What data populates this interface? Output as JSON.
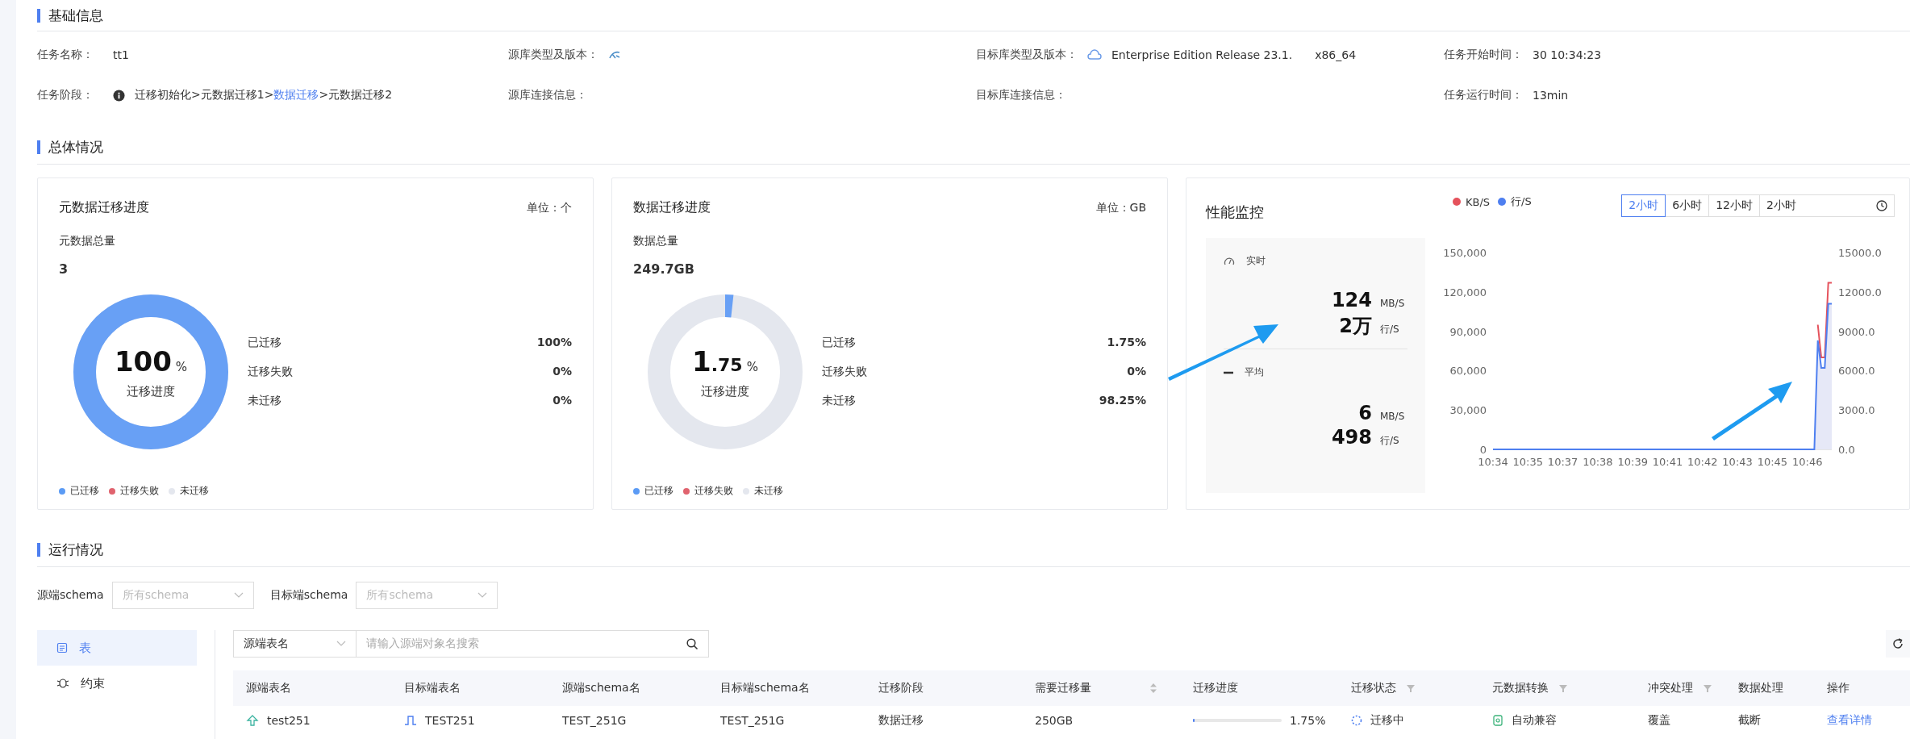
{
  "basic_info": {
    "title": "基础信息",
    "rows": [
      {
        "fields": [
          {
            "kind": "text",
            "label": "任务名称：",
            "value": "tt1"
          },
          {
            "kind": "icon",
            "label": "源库类型及版本："
          },
          {
            "kind": "icon_text",
            "label": "目标库类型及版本：",
            "value": "Enterprise Edition Release 23.1.",
            "extra": "x86_64"
          },
          {
            "kind": "text",
            "label": "任务开始时间：",
            "value": "30 10:34:23"
          }
        ]
      },
      {
        "fields": [
          {
            "kind": "stages",
            "label": "任务阶段：",
            "separator": ">",
            "stages": [
              {
                "text": "迁移初始化",
                "selected": false
              },
              {
                "text": "元数据迁移1",
                "selected": false
              },
              {
                "text": "数据迁移",
                "selected": true
              },
              {
                "text": "元数据迁移2",
                "selected": false
              }
            ]
          },
          {
            "kind": "label",
            "label": "源库连接信息："
          },
          {
            "kind": "label",
            "label": "目标库连接信息："
          },
          {
            "kind": "text",
            "label": "任务运行时间：",
            "value": "13min"
          }
        ]
      }
    ]
  },
  "overview": {
    "title": "总体情况",
    "cards": [
      {
        "title": "元数据迁移进度",
        "unit": "单位：个",
        "total_label": "元数据总量",
        "total": "3",
        "level": 1,
        "center_int": "100",
        "center_unit": "%",
        "center_label": "迁移进度",
        "stats": [
          {
            "label": "已迁移",
            "value": "100%"
          },
          {
            "label": "迁移失败",
            "value": "0%"
          },
          {
            "label": "未迁移",
            "value": "0%"
          }
        ],
        "legend": [
          {
            "label": "已迁移",
            "color": "#5b9bf5"
          },
          {
            "label": "迁移失败",
            "color": "#e0636e"
          },
          {
            "label": "未迁移",
            "color": "#e4e7ee"
          }
        ]
      },
      {
        "title": "数据迁移进度",
        "unit": "单位：GB",
        "total_label": "数据总量",
        "total": "249.7GB",
        "level": 0.0175,
        "center_int": "1",
        "center_frac": ".75",
        "center_unit": "%",
        "center_label": "迁移进度",
        "stats": [
          {
            "label": "已迁移",
            "value": "1.75%"
          },
          {
            "label": "迁移失败",
            "value": "0%"
          },
          {
            "label": "未迁移",
            "value": "98.25%"
          }
        ],
        "legend": [
          {
            "label": "已迁移",
            "color": "#5b9bf5"
          },
          {
            "label": "迁移失败",
            "color": "#e0636e"
          },
          {
            "label": "未迁移",
            "color": "#e4e7ee"
          }
        ]
      }
    ],
    "monitor": {
      "title": "性能监控",
      "realtime": {
        "label": "实时",
        "rows": [
          {
            "value": "124",
            "unit": "MB/S"
          },
          {
            "value": "2万",
            "unit": "行/S"
          }
        ]
      },
      "average": {
        "label": "平均",
        "rows": [
          {
            "value": "6",
            "unit": "MB/S"
          },
          {
            "value": "498",
            "unit": "行/S"
          }
        ]
      },
      "ranges": [
        {
          "label": "2小时",
          "selected": true
        },
        {
          "label": "6小时",
          "selected": false
        },
        {
          "label": "12小时",
          "selected": false
        }
      ],
      "range_select": "2小时",
      "chart_data": {
        "type": "line",
        "categories": [
          "10:34",
          null,
          null,
          null,
          null,
          null,
          null,
          null,
          null,
          null,
          "10:35",
          null,
          null,
          null,
          null,
          null,
          null,
          null,
          null,
          null,
          "10:37",
          null,
          null,
          null,
          null,
          null,
          null,
          null,
          null,
          null,
          "10:38",
          null,
          null,
          null,
          null,
          null,
          null,
          null,
          null,
          null,
          "10:39",
          null,
          null,
          null,
          null,
          null,
          null,
          null,
          null,
          null,
          "10:41",
          null,
          null,
          null,
          null,
          null,
          null,
          null,
          null,
          null,
          "10:42",
          null,
          null,
          null,
          null,
          null,
          null,
          null,
          null,
          null,
          "10:43",
          null,
          null,
          null,
          null,
          null,
          null,
          null,
          null,
          null,
          "10:45",
          null,
          null,
          null,
          null,
          null,
          null,
          null,
          null,
          null,
          "10:46",
          null,
          null,
          null,
          null,
          null,
          null,
          null
        ],
        "ylim": [
          0,
          150000
        ],
        "yticks": [
          {
            "value": 0,
            "label": "0"
          },
          {
            "value": 30000,
            "label": "30,000"
          },
          {
            "value": 60000,
            "label": "60,000"
          },
          {
            "value": 90000,
            "label": "90,000"
          },
          {
            "value": 120000,
            "label": "120,000"
          },
          {
            "value": 150000,
            "label": "150,000"
          }
        ],
        "y2lim": [
          0,
          15000
        ],
        "y2ticks": [
          {
            "value": 0,
            "label": "0.0"
          },
          {
            "value": 3000,
            "label": "3000.0"
          },
          {
            "value": 6000,
            "label": "6000.0"
          },
          {
            "value": 9000,
            "label": "9000.0"
          },
          {
            "value": 12000,
            "label": "12000.0"
          },
          {
            "value": 15000,
            "label": "15000.0"
          }
        ],
        "series": [
          {
            "name": "KB/S",
            "color": "#e5525c",
            "values": [
              null,
              null,
              null,
              null,
              null,
              null,
              null,
              null,
              null,
              null,
              null,
              null,
              null,
              null,
              null,
              null,
              null,
              null,
              null,
              null,
              null,
              null,
              null,
              null,
              null,
              null,
              null,
              null,
              null,
              null,
              null,
              null,
              null,
              null,
              null,
              null,
              null,
              null,
              null,
              null,
              null,
              null,
              null,
              null,
              null,
              null,
              null,
              null,
              null,
              null,
              null,
              null,
              null,
              null,
              null,
              null,
              null,
              null,
              null,
              null,
              null,
              null,
              null,
              null,
              null,
              null,
              null,
              null,
              null,
              null,
              null,
              null,
              null,
              null,
              null,
              null,
              null,
              null,
              null,
              null,
              null,
              null,
              null,
              null,
              null,
              null,
              null,
              null,
              null,
              null,
              null,
              null,
              null,
              95000,
              70000,
              70000,
              127000,
              127000
            ]
          },
          {
            "name": "行/S",
            "color": "#4e7ff0",
            "axis": "y2",
            "values": [
              0,
              0,
              0,
              0,
              0,
              0,
              0,
              0,
              0,
              0,
              0,
              0,
              0,
              0,
              0,
              0,
              0,
              0,
              0,
              0,
              0,
              0,
              0,
              0,
              0,
              0,
              0,
              0,
              0,
              0,
              0,
              0,
              0,
              0,
              0,
              0,
              0,
              0,
              0,
              0,
              0,
              0,
              0,
              0,
              0,
              0,
              0,
              0,
              0,
              0,
              0,
              0,
              0,
              0,
              0,
              0,
              0,
              0,
              0,
              0,
              0,
              0,
              0,
              0,
              0,
              0,
              0,
              0,
              0,
              0,
              0,
              0,
              0,
              0,
              0,
              0,
              0,
              0,
              0,
              0,
              0,
              0,
              0,
              0,
              0,
              0,
              0,
              0,
              0,
              0,
              0,
              0,
              0,
              8300,
              6200,
              6200,
              11100,
              11100
            ]
          }
        ]
      }
    }
  },
  "running": {
    "title": "运行情况",
    "filters": [
      {
        "label": "源端schema",
        "placeholder": "所有schema"
      },
      {
        "label": "目标端schema",
        "placeholder": "所有schema"
      }
    ],
    "side_tabs": [
      {
        "label": "表",
        "selected": true
      },
      {
        "label": "约束",
        "selected": false
      }
    ],
    "search": {
      "field": "源端表名",
      "placeholder": "请输入源端对象名搜索"
    },
    "table": {
      "columns": [
        {
          "label": "源端表名",
          "kind": "plain"
        },
        {
          "label": "目标端表名",
          "kind": "plain"
        },
        {
          "label": "源端schema名",
          "kind": "plain"
        },
        {
          "label": "目标端schema名",
          "kind": "plain"
        },
        {
          "label": "迁移阶段",
          "kind": "plain"
        },
        {
          "label": "需要迁移量",
          "kind": "sort"
        },
        {
          "label": "迁移进度",
          "kind": "plain"
        },
        {
          "label": "迁移状态",
          "kind": "filter"
        },
        {
          "label": "元数据转换",
          "kind": "filter"
        },
        {
          "label": "冲突处理",
          "kind": "filter"
        },
        {
          "label": "数据处理",
          "kind": "plain"
        },
        {
          "label": "操作",
          "kind": "plain"
        }
      ],
      "rows": [
        {
          "source_table": "test251",
          "target_table": "TEST251",
          "source_schema": "TEST_251G",
          "target_schema": "TEST_251G",
          "stage": "数据迁移",
          "amount": "250GB",
          "level": 0.0175,
          "progress": "1.75%",
          "status": "迁移中",
          "meta": "自动兼容",
          "conflict": "覆盖",
          "data_handling": "截断",
          "action": "查看详情"
        }
      ]
    }
  }
}
